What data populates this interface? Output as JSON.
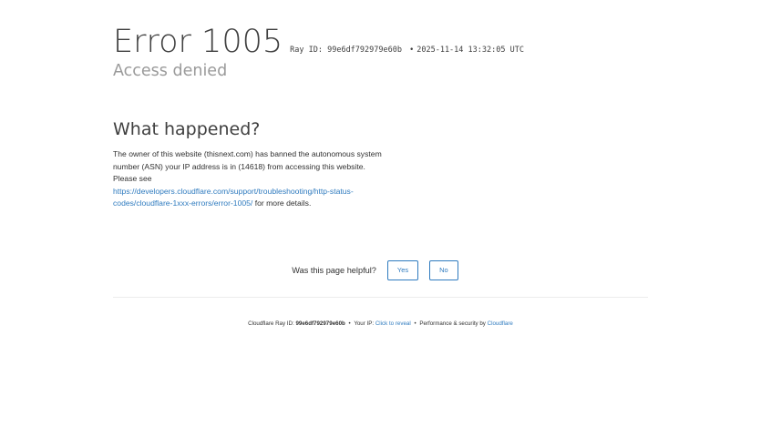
{
  "header": {
    "error_title": "Error 1005",
    "ray_label": "Ray ID:",
    "ray_id": "99e6df792979e60b",
    "separator": "•",
    "timestamp": "2025-11-14 13:32:05 UTC",
    "subtitle": "Access denied"
  },
  "what_happened": {
    "heading": "What happened?",
    "line1": "The owner of this website (thisnext.com) has banned the autonomous system number (ASN) your IP address is in (14618) from accessing this website.",
    "please_see": "Please see",
    "link_text": "https://developers.cloudflare.com/support/troubleshooting/http-status-codes/cloudflare-1xxx-errors/error-1005/",
    "after_link": " for more details."
  },
  "feedback": {
    "question": "Was this page helpful?",
    "yes_label": "Yes",
    "no_label": "No"
  },
  "footer": {
    "ray_label": "Cloudflare Ray ID:",
    "ray_id": "99e6df792979e60b",
    "separator": "•",
    "ip_label": "Your IP:",
    "reveal_link": "Click to reveal",
    "perf_text": "Performance & security by",
    "cloudflare_link": "Cloudflare"
  },
  "colors": {
    "link": "#2f7bbf",
    "subtitle": "#9a9a9a",
    "text": "#313131"
  }
}
